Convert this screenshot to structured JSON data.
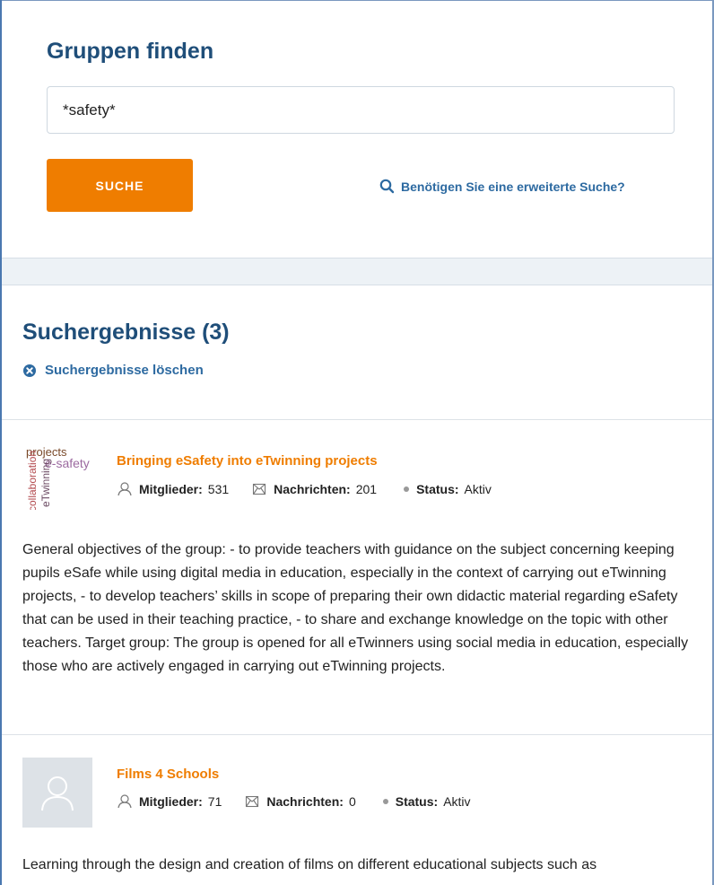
{
  "search": {
    "title": "Gruppen finden",
    "query": "*safety*",
    "button_label": "SUCHE",
    "advanced_link": "Benötigen Sie eine erweiterte Suche?"
  },
  "results": {
    "title": "Suchergebnisse (3)",
    "clear_label": "Suchergebnisse löschen",
    "groups": [
      {
        "title": "Bringing eSafety into eTwinning projects",
        "members_label": "Mitglieder:",
        "members": "531",
        "messages_label": "Nachrichten:",
        "messages": "201",
        "status_label": "Status:",
        "status": "Aktiv",
        "logo_words": [
          "projects",
          "e-safety",
          "collaboration",
          "eTwinning"
        ],
        "description": "General objectives of the group: - to provide teachers with guidance on the subject concerning keeping pupils eSafe while using digital media in education, especially in the context of carrying out eTwinning projects, - to develop teachers’ skills in scope of preparing their own didactic material regarding eSafety that can be used in their teaching practice, - to share and exchange knowledge on the topic with other teachers. Target group: The group is opened for all eTwinners using social media in education, especially those who are actively engaged in carrying out eTwinning projects."
      },
      {
        "title": "Films 4 Schools",
        "members_label": "Mitglieder:",
        "members": "71",
        "messages_label": "Nachrichten:",
        "messages": "0",
        "status_label": "Status:",
        "status": "Aktiv",
        "description": "Learning through the design and creation of films on different educational subjects such as"
      }
    ]
  },
  "colors": {
    "heading": "#1f4e79",
    "accent": "#ef7d00",
    "link": "#2d6aa1",
    "band": "#edf2f6"
  },
  "icons": [
    "search-icon",
    "clear-circle-icon",
    "user-icon",
    "envelope-icon",
    "status-dot-icon",
    "avatar-placeholder-icon"
  ]
}
